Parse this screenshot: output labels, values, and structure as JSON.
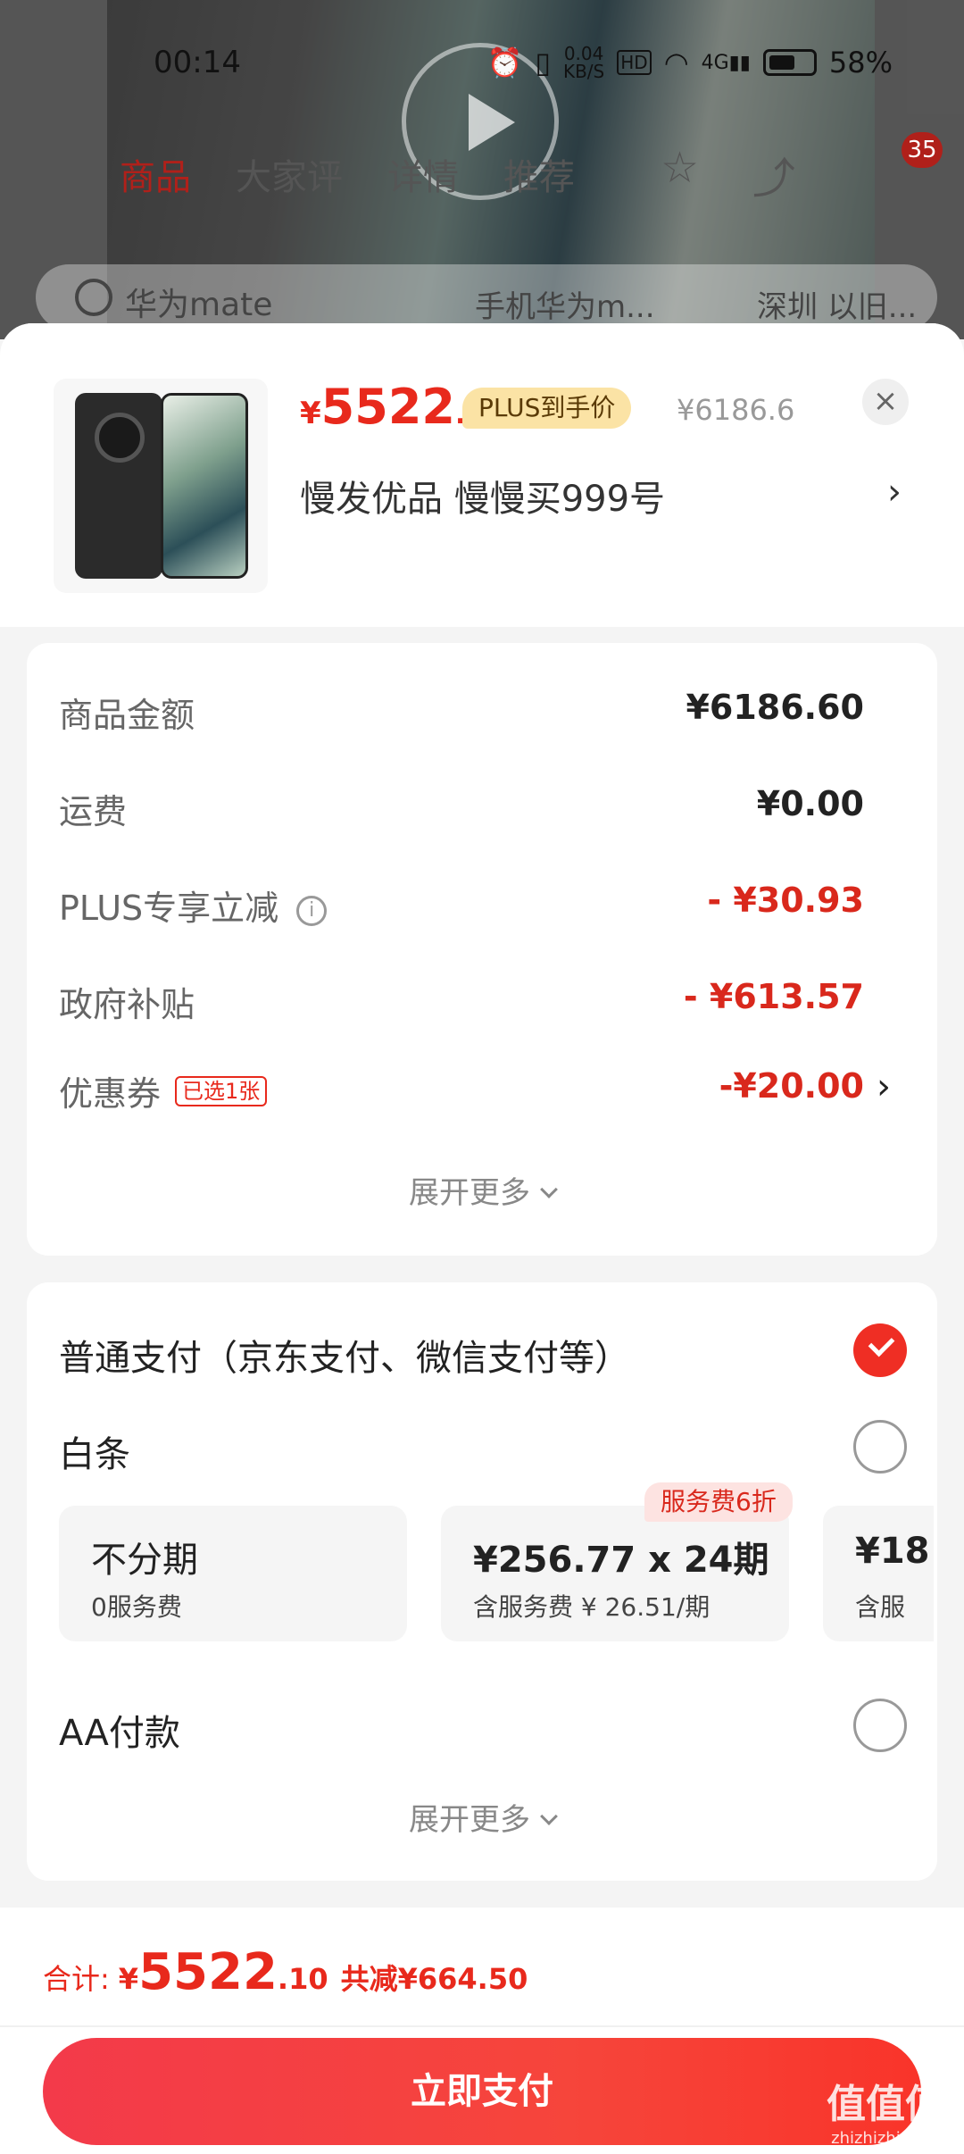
{
  "status_bar": {
    "time": "00:14",
    "speed": "0.04",
    "speed_unit": "KB/S",
    "hd": "HD",
    "network": "4G",
    "battery": "58%"
  },
  "product_page": {
    "tabs": [
      "商品",
      "大家评",
      "详情",
      "推荐"
    ],
    "cart_count": "35",
    "search_query": "华为mate",
    "search_chip_1": "手机华为m...",
    "search_chip_2": "深圳 以旧..."
  },
  "product": {
    "currency": "¥",
    "price_int": "5522",
    "price_dec": ".1",
    "plus_tag": "PLUS到手价",
    "original_price": "¥6186.6",
    "shop_name": "慢发优品  慢慢买999号",
    "close_symbol": "×",
    "arrow": "›"
  },
  "breakdown": {
    "rows": [
      {
        "label": "商品金额",
        "value": "¥6186.60"
      },
      {
        "label": "运费",
        "value": "¥0.00"
      },
      {
        "label": "PLUS专享立减",
        "value": "- ¥30.93"
      },
      {
        "label": "政府补贴",
        "value": "- ¥613.57"
      },
      {
        "label": "优惠券",
        "value": "-¥20.00"
      }
    ],
    "info_symbol": "i",
    "coupon_tag": "已选1张",
    "expand_label": "展开更多"
  },
  "payment": {
    "standard": "普通支付（京东支付、微信支付等）",
    "baitiao": "白条",
    "discount_badge": "服务费6折",
    "plans": [
      {
        "title": "不分期",
        "sub": "0服务费"
      },
      {
        "title": "¥256.77 x 24期",
        "sub": "含服务费 ¥ 26.51/期"
      },
      {
        "title": "¥18",
        "sub": "含服"
      }
    ],
    "aa": "AA付款",
    "expand_label": "展开更多"
  },
  "footer": {
    "total_label": "合计:",
    "currency": "¥",
    "total_int": "5522",
    "total_dec": ".10",
    "saving": "共减¥664.50",
    "pay_button": "立即支付"
  },
  "watermark": {
    "big": "值值值",
    "small": "zhizhizhi.com"
  },
  "colors": {
    "accent": "#e8291c",
    "plus_tag_bg": "#fbe3a5",
    "button": "#f6453b"
  }
}
